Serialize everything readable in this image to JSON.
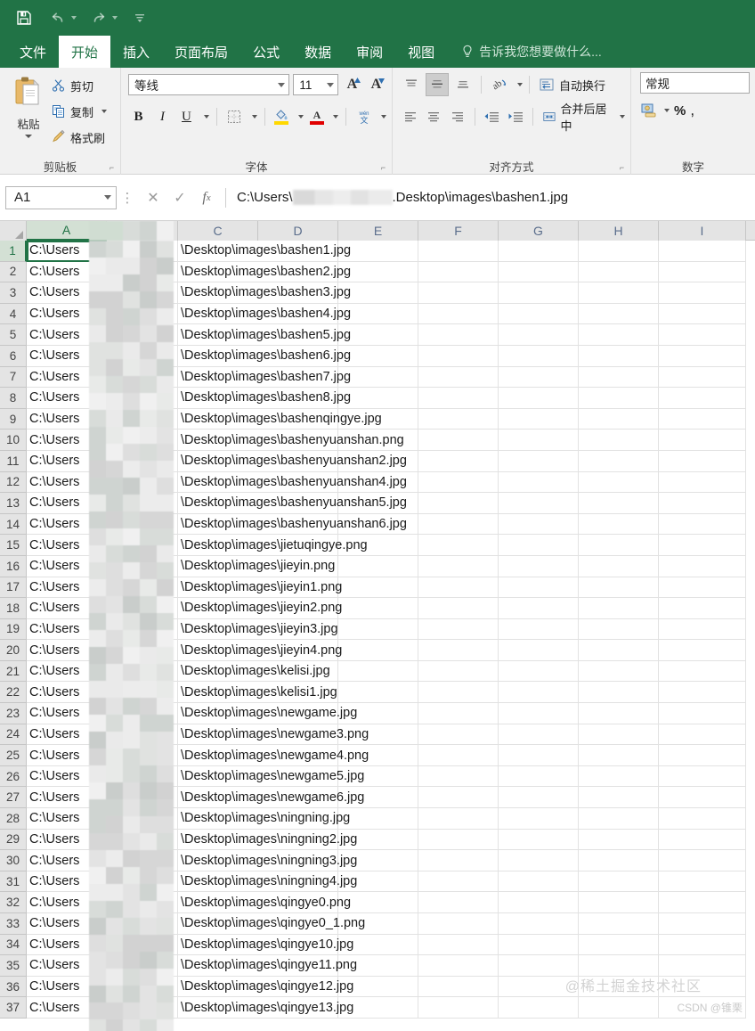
{
  "quick_access": {
    "save_label": "保存",
    "undo_label": "撤销",
    "redo_label": "恢复",
    "customize_label": "自定义快速访问工具栏"
  },
  "theme": {
    "accent": "#217346",
    "ribbon_bg": "#f1f1f1",
    "header_bg": "#e4e4e4",
    "selected_header_bg": "#d3e0d4"
  },
  "tabs": [
    {
      "label": "文件",
      "active": false
    },
    {
      "label": "开始",
      "active": true
    },
    {
      "label": "插入",
      "active": false
    },
    {
      "label": "页面布局",
      "active": false
    },
    {
      "label": "公式",
      "active": false
    },
    {
      "label": "数据",
      "active": false
    },
    {
      "label": "审阅",
      "active": false
    },
    {
      "label": "视图",
      "active": false
    }
  ],
  "tell_me": "告诉我您想要做什么...",
  "ribbon": {
    "clipboard": {
      "group_label": "剪贴板",
      "paste_label": "粘贴",
      "cut_label": "剪切",
      "copy_label": "复制",
      "format_painter_label": "格式刷"
    },
    "font": {
      "group_label": "字体",
      "font_name": "等线",
      "font_size": "11",
      "grow_font_label": "增大字号",
      "shrink_font_label": "减小字号",
      "bold_label": "B",
      "italic_label": "I",
      "underline_label": "U",
      "borders_label": "边框",
      "fill_color_label": "填充颜色",
      "font_color_label": "字体颜色",
      "phonetic_label": "拼音",
      "fill_color": "#ffd800",
      "font_color": "#e00000"
    },
    "alignment": {
      "group_label": "对齐方式",
      "align_top_label": "顶端对齐",
      "align_middle_label": "垂直居中",
      "align_bottom_label": "底端对齐",
      "orientation_label": "方向",
      "wrap_text_label": "自动换行",
      "align_left_label": "左对齐",
      "align_center_label": "居中",
      "align_right_label": "右对齐",
      "decrease_indent_label": "减少缩进量",
      "increase_indent_label": "增加缩进量",
      "merge_center_label": "合并后居中"
    },
    "number": {
      "group_label": "数字",
      "format": "常规",
      "accounting_label": "会计数字格式",
      "percent_label": "%",
      "comma_label": ","
    }
  },
  "formula_bar": {
    "name_box": "A1",
    "cancel_label": "取消",
    "enter_label": "输入",
    "function_label": "fx",
    "value_prefix": "C:\\Users\\",
    "value_suffix": ".Desktop\\images\\bashen1.jpg",
    "redacted": true
  },
  "grid": {
    "columns": [
      "A",
      "B",
      "C",
      "D",
      "E",
      "F",
      "G",
      "H",
      "I"
    ],
    "selected_cell": "A1",
    "selected_column": "A",
    "selected_row": 1,
    "column_b_redacted": true,
    "rows": [
      {
        "n": 1,
        "a": "C:\\Users",
        "c": "\\Desktop\\images\\bashen1.jpg"
      },
      {
        "n": 2,
        "a": "C:\\Users",
        "c": "\\Desktop\\images\\bashen2.jpg"
      },
      {
        "n": 3,
        "a": "C:\\Users",
        "c": "\\Desktop\\images\\bashen3.jpg"
      },
      {
        "n": 4,
        "a": "C:\\Users",
        "c": "\\Desktop\\images\\bashen4.jpg"
      },
      {
        "n": 5,
        "a": "C:\\Users",
        "c": "\\Desktop\\images\\bashen5.jpg"
      },
      {
        "n": 6,
        "a": "C:\\Users",
        "c": "\\Desktop\\images\\bashen6.jpg"
      },
      {
        "n": 7,
        "a": "C:\\Users",
        "c": "\\Desktop\\images\\bashen7.jpg"
      },
      {
        "n": 8,
        "a": "C:\\Users",
        "c": "\\Desktop\\images\\bashen8.jpg"
      },
      {
        "n": 9,
        "a": "C:\\Users",
        "c": "\\Desktop\\images\\bashenqingye.jpg"
      },
      {
        "n": 10,
        "a": "C:\\Users",
        "c": "\\Desktop\\images\\bashenyuanshan.png"
      },
      {
        "n": 11,
        "a": "C:\\Users",
        "c": "\\Desktop\\images\\bashenyuanshan2.jpg"
      },
      {
        "n": 12,
        "a": "C:\\Users",
        "c": "\\Desktop\\images\\bashenyuanshan4.jpg"
      },
      {
        "n": 13,
        "a": "C:\\Users",
        "c": "\\Desktop\\images\\bashenyuanshan5.jpg"
      },
      {
        "n": 14,
        "a": "C:\\Users",
        "c": "\\Desktop\\images\\bashenyuanshan6.jpg"
      },
      {
        "n": 15,
        "a": "C:\\Users",
        "c": "\\Desktop\\images\\jietuqingye.png"
      },
      {
        "n": 16,
        "a": "C:\\Users",
        "c": "\\Desktop\\images\\jieyin.png"
      },
      {
        "n": 17,
        "a": "C:\\Users",
        "c": "\\Desktop\\images\\jieyin1.png"
      },
      {
        "n": 18,
        "a": "C:\\Users",
        "c": "\\Desktop\\images\\jieyin2.png"
      },
      {
        "n": 19,
        "a": "C:\\Users",
        "c": "\\Desktop\\images\\jieyin3.jpg"
      },
      {
        "n": 20,
        "a": "C:\\Users",
        "c": "\\Desktop\\images\\jieyin4.png"
      },
      {
        "n": 21,
        "a": "C:\\Users",
        "c": "\\Desktop\\images\\kelisi.jpg"
      },
      {
        "n": 22,
        "a": "C:\\Users",
        "c": "\\Desktop\\images\\kelisi1.jpg"
      },
      {
        "n": 23,
        "a": "C:\\Users",
        "c": "\\Desktop\\images\\newgame.jpg"
      },
      {
        "n": 24,
        "a": "C:\\Users",
        "c": "\\Desktop\\images\\newgame3.png"
      },
      {
        "n": 25,
        "a": "C:\\Users",
        "c": "\\Desktop\\images\\newgame4.png"
      },
      {
        "n": 26,
        "a": "C:\\Users",
        "c": "\\Desktop\\images\\newgame5.jpg"
      },
      {
        "n": 27,
        "a": "C:\\Users",
        "c": "\\Desktop\\images\\newgame6.jpg"
      },
      {
        "n": 28,
        "a": "C:\\Users",
        "c": "\\Desktop\\images\\ningning.jpg"
      },
      {
        "n": 29,
        "a": "C:\\Users",
        "c": "\\Desktop\\images\\ningning2.jpg"
      },
      {
        "n": 30,
        "a": "C:\\Users",
        "c": "\\Desktop\\images\\ningning3.jpg"
      },
      {
        "n": 31,
        "a": "C:\\Users",
        "c": "\\Desktop\\images\\ningning4.jpg"
      },
      {
        "n": 32,
        "a": "C:\\Users",
        "c": "\\Desktop\\images\\qingye0.png"
      },
      {
        "n": 33,
        "a": "C:\\Users",
        "c": "\\Desktop\\images\\qingye0_1.png"
      },
      {
        "n": 34,
        "a": "C:\\Users",
        "c": "\\Desktop\\images\\qingye10.jpg"
      },
      {
        "n": 35,
        "a": "C:\\Users",
        "c": "\\Desktop\\images\\qingye11.png"
      },
      {
        "n": 36,
        "a": "C:\\Users",
        "c": "\\Desktop\\images\\qingye12.jpg"
      },
      {
        "n": 37,
        "a": "C:\\Users",
        "c": "\\Desktop\\images\\qingye13.jpg"
      }
    ]
  },
  "watermarks": {
    "juejin": "@稀土掘金技术社区",
    "csdn": "CSDN @锥栗"
  }
}
